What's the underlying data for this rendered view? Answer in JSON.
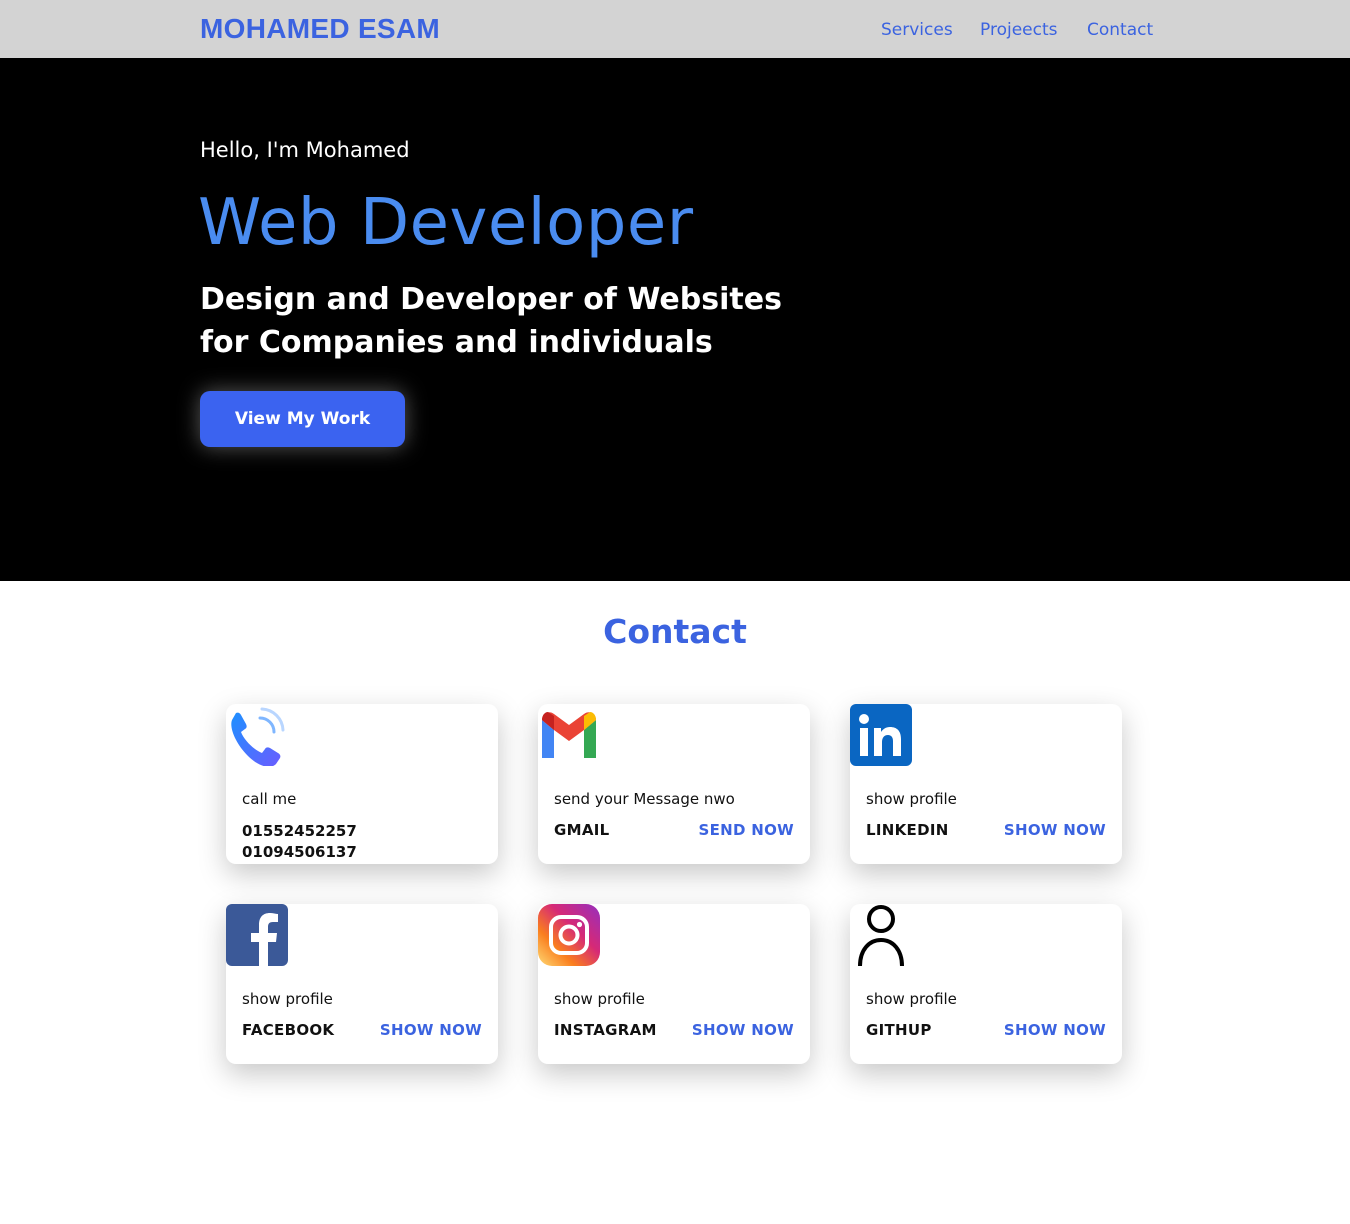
{
  "header": {
    "brand": "MOHAMED ESAM",
    "nav": [
      "Services",
      "Projeects",
      "Contact"
    ]
  },
  "hero": {
    "greeting": "Hello, I'm Mohamed",
    "role": "Web Developer",
    "tagline_line1": "Design and Developer of Websites",
    "tagline_line2": "for Companies and individuals",
    "cta_label": "View My Work"
  },
  "contact": {
    "title": "Contact",
    "cards": [
      {
        "icon": "phone-icon",
        "subtitle": "call me",
        "phones": [
          "01552452257",
          "01094506137"
        ]
      },
      {
        "icon": "gmail-icon",
        "subtitle": "send your Message nwo",
        "name": "GMAIL",
        "action": "SEND NOW"
      },
      {
        "icon": "linkedin-icon",
        "subtitle": "show profile",
        "name": "LINKEDIN",
        "action": "SHOW NOW"
      },
      {
        "icon": "facebook-icon",
        "subtitle": "show profile",
        "name": "FACEBOOK",
        "action": "SHOW NOW"
      },
      {
        "icon": "instagram-icon",
        "subtitle": "show profile",
        "name": "INSTAGRAM",
        "action": "SHOW NOW"
      },
      {
        "icon": "user-icon",
        "subtitle": "show profile",
        "name": "GITHUP",
        "action": "SHOW NOW"
      }
    ]
  },
  "colors": {
    "accent": "#3b63e0",
    "hero_role": "#4a8cf0",
    "navbar_bg": "#d3d3d3",
    "hero_bg": "#000000"
  }
}
